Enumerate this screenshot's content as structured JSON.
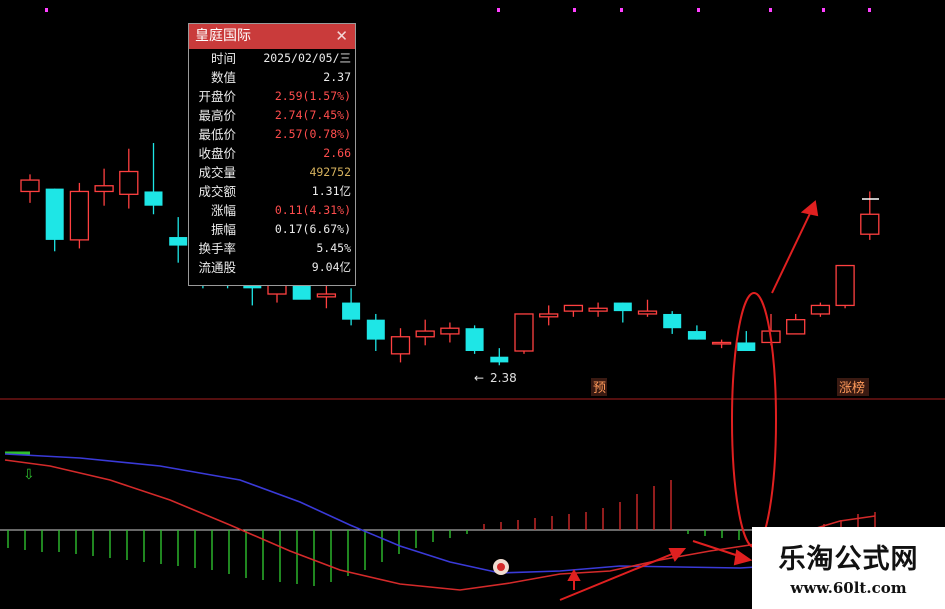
{
  "info_panel": {
    "title": "皇庭国际",
    "rows": [
      {
        "label": "时间",
        "value": "2025/02/05/三",
        "color": "#ececec"
      },
      {
        "label": "数值",
        "value": "2.37",
        "color": "#ececec"
      },
      {
        "label": "开盘价",
        "value": "2.59(1.57%)",
        "color": "#ff4d4d"
      },
      {
        "label": "最高价",
        "value": "2.74(7.45%)",
        "color": "#ff4d4d"
      },
      {
        "label": "最低价",
        "value": "2.57(0.78%)",
        "color": "#ff4d4d"
      },
      {
        "label": "收盘价",
        "value": "2.66",
        "color": "#ff4d4d"
      },
      {
        "label": "成交量",
        "value": "492752",
        "color": "#d6b25e"
      },
      {
        "label": "成交额",
        "value": "1.31亿",
        "color": "#ececec"
      },
      {
        "label": "涨幅",
        "value": "0.11(4.31%)",
        "color": "#ff4d4d"
      },
      {
        "label": "振幅",
        "value": "0.17(6.67%)",
        "color": "#ececec"
      },
      {
        "label": "换手率",
        "value": "5.45%",
        "color": "#ececec"
      },
      {
        "label": "流通股",
        "value": "9.04亿",
        "color": "#ececec"
      }
    ]
  },
  "chart_data": {
    "type": "candlestick",
    "low_annotation": "2.38",
    "markers": [
      {
        "text": "预"
      },
      {
        "text": "涨榜"
      }
    ],
    "colors": {
      "up": "#ff4040",
      "down": "#1ee6e6",
      "background": "#000000",
      "fast_line": "#d42a2a",
      "slow_line": "#3a3ad8",
      "hist_pos": "#d02a2a",
      "hist_neg": "#2fbf2f"
    },
    "candles": [
      {
        "o": 2.74,
        "h": 2.8,
        "l": 2.7,
        "c": 2.78
      },
      {
        "o": 2.75,
        "h": 2.75,
        "l": 2.53,
        "c": 2.57
      },
      {
        "o": 2.57,
        "h": 2.77,
        "l": 2.54,
        "c": 2.74
      },
      {
        "o": 2.74,
        "h": 2.82,
        "l": 2.69,
        "c": 2.76
      },
      {
        "o": 2.73,
        "h": 2.89,
        "l": 2.68,
        "c": 2.81
      },
      {
        "o": 2.74,
        "h": 2.91,
        "l": 2.66,
        "c": 2.69
      },
      {
        "o": 2.58,
        "h": 2.65,
        "l": 2.49,
        "c": 2.55
      },
      {
        "o": 2.52,
        "h": 2.53,
        "l": 2.4,
        "c": 2.48
      },
      {
        "o": 2.47,
        "h": 2.49,
        "l": 2.4,
        "c": 2.43
      },
      {
        "o": 2.44,
        "h": 2.46,
        "l": 2.34,
        "c": 2.4
      },
      {
        "o": 2.38,
        "h": 2.44,
        "l": 2.35,
        "c": 2.43
      },
      {
        "o": 2.43,
        "h": 2.46,
        "l": 2.37,
        "c": 2.36
      },
      {
        "o": 2.37,
        "h": 2.43,
        "l": 2.33,
        "c": 2.38
      },
      {
        "o": 2.35,
        "h": 2.4,
        "l": 2.27,
        "c": 2.29
      },
      {
        "o": 2.29,
        "h": 2.31,
        "l": 2.18,
        "c": 2.22
      },
      {
        "o": 2.17,
        "h": 2.26,
        "l": 2.14,
        "c": 2.23
      },
      {
        "o": 2.23,
        "h": 2.29,
        "l": 2.2,
        "c": 2.25
      },
      {
        "o": 2.24,
        "h": 2.28,
        "l": 2.21,
        "c": 2.26
      },
      {
        "o": 2.26,
        "h": 2.27,
        "l": 2.17,
        "c": 2.18
      },
      {
        "o": 2.16,
        "h": 2.19,
        "l": 2.13,
        "c": 2.14
      },
      {
        "o": 2.18,
        "h": 2.31,
        "l": 2.17,
        "c": 2.31
      },
      {
        "o": 2.3,
        "h": 2.34,
        "l": 2.27,
        "c": 2.31
      },
      {
        "o": 2.32,
        "h": 2.34,
        "l": 2.3,
        "c": 2.34
      },
      {
        "o": 2.32,
        "h": 2.35,
        "l": 2.3,
        "c": 2.33
      },
      {
        "o": 2.35,
        "h": 2.35,
        "l": 2.28,
        "c": 2.32
      },
      {
        "o": 2.31,
        "h": 2.36,
        "l": 2.3,
        "c": 2.32
      },
      {
        "o": 2.31,
        "h": 2.32,
        "l": 2.24,
        "c": 2.26
      },
      {
        "o": 2.25,
        "h": 2.27,
        "l": 2.22,
        "c": 2.22
      },
      {
        "o": 2.21,
        "h": 2.22,
        "l": 2.19,
        "c": 2.21
      },
      {
        "o": 2.21,
        "h": 2.25,
        "l": 2.19,
        "c": 2.18
      },
      {
        "o": 2.21,
        "h": 2.31,
        "l": 2.2,
        "c": 2.25
      },
      {
        "o": 2.24,
        "h": 2.31,
        "l": 2.24,
        "c": 2.29
      },
      {
        "o": 2.31,
        "h": 2.35,
        "l": 2.3,
        "c": 2.34
      },
      {
        "o": 2.34,
        "h": 2.48,
        "l": 2.33,
        "c": 2.48
      },
      {
        "o": 2.59,
        "h": 2.74,
        "l": 2.57,
        "c": 2.66
      }
    ],
    "last_close": 2.66
  }
}
